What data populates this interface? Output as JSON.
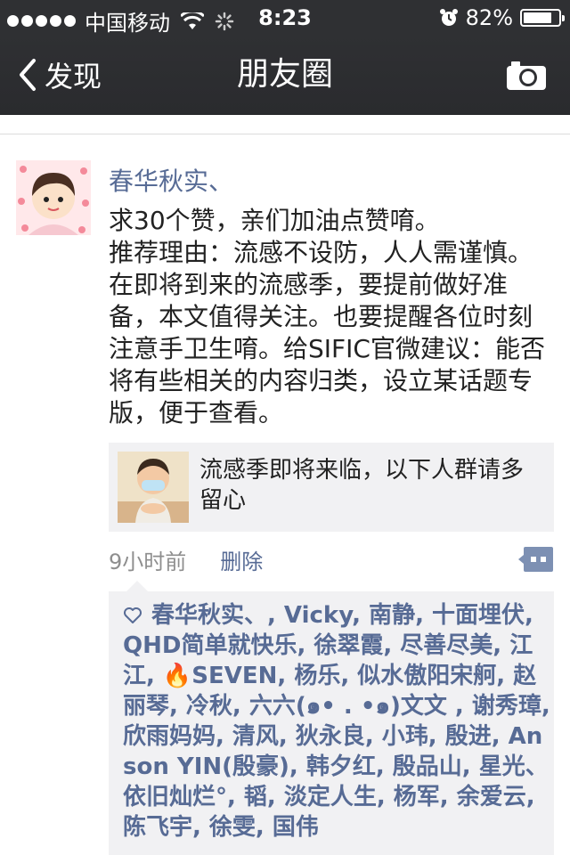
{
  "status_bar": {
    "carrier": "中国移动",
    "time": "8:23",
    "battery": "82%",
    "battery_level": 0.82
  },
  "nav": {
    "back_label": "发现",
    "title": "朋友圈"
  },
  "post": {
    "author": "春华秋实、",
    "text": "求30个赞，亲们加油点赞唷。\n推荐理由：流感不设防，人人需谨慎。在即将到来的流感季，要提前做好准备，本文值得关注。也要提醒各位时刻注意手卫生唷。给SIFIC官微建议：能否将有些相关的内容归类，设立某话题专版，便于查看。",
    "link_title": "流感季即将来临，以下人群请多留心",
    "time": "9小时前",
    "delete_label": "删除",
    "likes_text": "春华秋实、, Vicky, 南静, 十面埋伏, QHD简单就快乐, 徐翠霞, 尽善尽美, 江江, 🔥SEVEN, 杨乐, 似水傲阳宋舸, 赵丽琴, 冷秋, 六六(๑• . •๑)文文 , 谢秀璋, 欣雨妈妈, 清风, 狄永良, 小玮, 殷进, Anson YIN(殷豪), 韩夕红, 殷品山, 星光、依旧灿烂°, 韬, 淡定人生, 杨军, 余爱云, 陈飞宇, 徐雯, 国伟"
  },
  "colors": {
    "bar": "#2f3033",
    "link": "#576b95",
    "panel": "#f1f1f3"
  },
  "icons": {
    "back": "chevron-left-icon",
    "camera": "camera-icon",
    "comment": "comment-icon",
    "heart": "heart-outline-icon"
  }
}
